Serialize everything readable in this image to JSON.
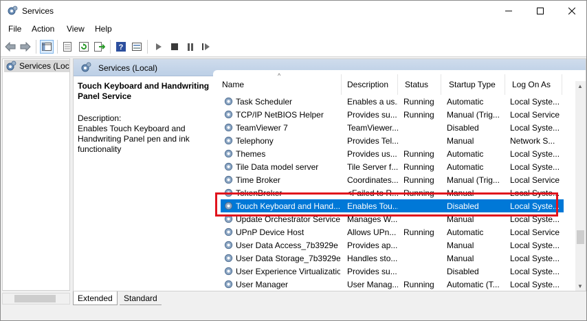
{
  "window": {
    "title": "Services"
  },
  "menu": {
    "items": [
      "File",
      "Action",
      "View",
      "Help"
    ]
  },
  "toolbar": {
    "icons": [
      "back-icon",
      "forward-icon",
      "show-hide-tree-icon",
      "properties-icon",
      "refresh-icon",
      "export-icon",
      "help-icon",
      "view-icon",
      "start-icon",
      "stop-icon",
      "pause-icon",
      "restart-icon"
    ]
  },
  "tree": {
    "items": [
      {
        "label": "Services (Local)"
      }
    ]
  },
  "main": {
    "header_title": "Services (Local)",
    "detail": {
      "title": "Touch Keyboard and Handwriting Panel Service",
      "desc_label": "Description:",
      "desc": "Enables Touch Keyboard and Handwriting Panel pen and ink functionality"
    },
    "columns": [
      "Name",
      "Description",
      "Status",
      "Startup Type",
      "Log On As"
    ],
    "rows": [
      [
        "Task Scheduler",
        "Enables a us...",
        "Running",
        "Automatic",
        "Local Syste..."
      ],
      [
        "TCP/IP NetBIOS Helper",
        "Provides su...",
        "Running",
        "Manual (Trig...",
        "Local Service"
      ],
      [
        "TeamViewer 7",
        "TeamViewer...",
        "",
        "Disabled",
        "Local Syste..."
      ],
      [
        "Telephony",
        "Provides Tel...",
        "",
        "Manual",
        "Network S..."
      ],
      [
        "Themes",
        "Provides us...",
        "Running",
        "Automatic",
        "Local Syste..."
      ],
      [
        "Tile Data model server",
        "Tile Server f...",
        "Running",
        "Automatic",
        "Local Syste..."
      ],
      [
        "Time Broker",
        "Coordinates...",
        "Running",
        "Manual (Trig...",
        "Local Service"
      ],
      [
        "TokenBroker",
        "<Failed to R...",
        "Running",
        "Manual",
        "Local Syste..."
      ],
      [
        "Touch Keyboard and Hand...",
        "Enables Tou...",
        "",
        "Disabled",
        "Local Syste..."
      ],
      [
        "Update Orchestrator Service",
        "Manages W...",
        "",
        "Manual",
        "Local Syste..."
      ],
      [
        "UPnP Device Host",
        "Allows UPn...",
        "Running",
        "Automatic",
        "Local Service"
      ],
      [
        "User Data Access_7b3929e",
        "Provides ap...",
        "",
        "Manual",
        "Local Syste..."
      ],
      [
        "User Data Storage_7b3929e",
        "Handles sto...",
        "",
        "Manual",
        "Local Syste..."
      ],
      [
        "User Experience Virtualizatio...",
        "Provides su...",
        "",
        "Disabled",
        "Local Syste..."
      ],
      [
        "User Manager",
        "User Manag...",
        "Running",
        "Automatic (T...",
        "Local Syste..."
      ]
    ],
    "selected_row": 8
  },
  "tabs": [
    {
      "label": "Extended"
    },
    {
      "label": "Standard"
    }
  ],
  "colors": {
    "selection": "#0078d7",
    "annotation": "#e0131d",
    "header": "#c6d6ea"
  }
}
